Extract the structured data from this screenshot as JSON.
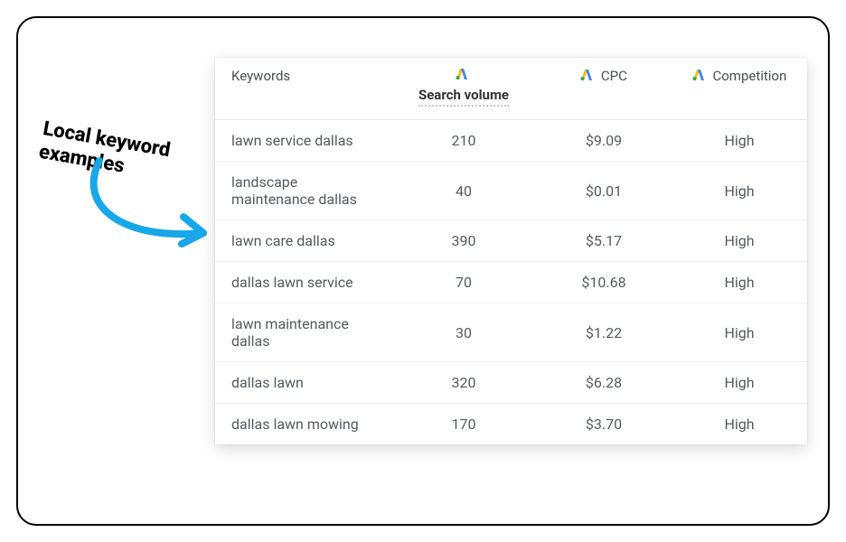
{
  "annotation": "Local keyword examples",
  "headers": {
    "keywords": "Keywords",
    "search_volume": "Search volume",
    "cpc": "CPC",
    "competition": "Competition"
  },
  "rows": [
    {
      "keyword": "lawn service dallas",
      "search_volume": "210",
      "cpc": "$9.09",
      "competition": "High"
    },
    {
      "keyword": "landscape maintenance dallas",
      "search_volume": "40",
      "cpc": "$0.01",
      "competition": "High"
    },
    {
      "keyword": "lawn care dallas",
      "search_volume": "390",
      "cpc": "$5.17",
      "competition": "High"
    },
    {
      "keyword": "dallas lawn service",
      "search_volume": "70",
      "cpc": "$10.68",
      "competition": "High"
    },
    {
      "keyword": "lawn maintenance dallas",
      "search_volume": "30",
      "cpc": "$1.22",
      "competition": "High"
    },
    {
      "keyword": "dallas lawn",
      "search_volume": "320",
      "cpc": "$6.28",
      "competition": "High"
    },
    {
      "keyword": "dallas lawn mowing",
      "search_volume": "170",
      "cpc": "$3.70",
      "competition": "High"
    }
  ],
  "chart_data": {
    "type": "table",
    "columns": [
      "Keywords",
      "Search volume",
      "CPC",
      "Competition"
    ],
    "rows": [
      [
        "lawn service dallas",
        210,
        9.09,
        "High"
      ],
      [
        "landscape maintenance dallas",
        40,
        0.01,
        "High"
      ],
      [
        "lawn care dallas",
        390,
        5.17,
        "High"
      ],
      [
        "dallas lawn service",
        70,
        10.68,
        "High"
      ],
      [
        "lawn maintenance dallas",
        30,
        1.22,
        "High"
      ],
      [
        "dallas lawn",
        320,
        6.28,
        "High"
      ],
      [
        "dallas lawn mowing",
        170,
        3.7,
        "High"
      ]
    ]
  }
}
